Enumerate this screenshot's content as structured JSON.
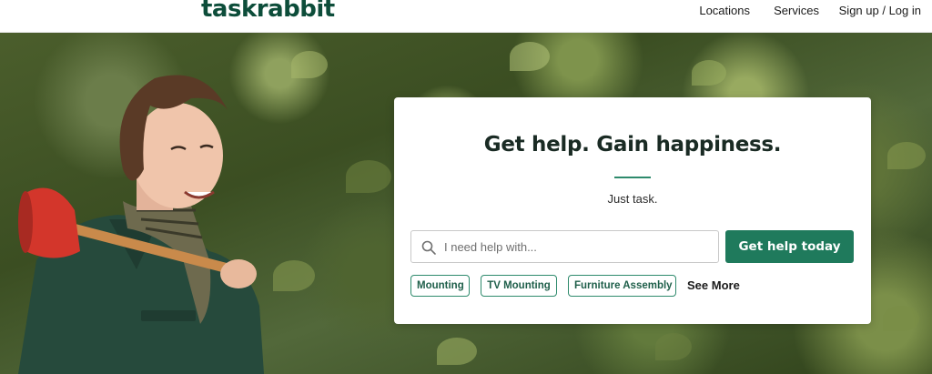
{
  "header": {
    "logo": "taskrabbit",
    "nav": {
      "locations": "Locations",
      "services": "Services",
      "signup": "Sign up / Log in"
    }
  },
  "hero": {
    "title": "Get help. Gain happiness.",
    "subtitle": "Just task.",
    "search": {
      "placeholder": "I need help with...",
      "value": ""
    },
    "cta_label": "Get help today",
    "chips": [
      "Mounting",
      "TV Mounting",
      "Furniture Assembly"
    ],
    "see_more": "See More"
  },
  "icons": {
    "search": "search-icon",
    "person": "person-with-plunger-image"
  },
  "colors": {
    "brand": "#0d4d3a",
    "accent": "#1f7a5c",
    "chip_border": "#2e8a6c"
  }
}
